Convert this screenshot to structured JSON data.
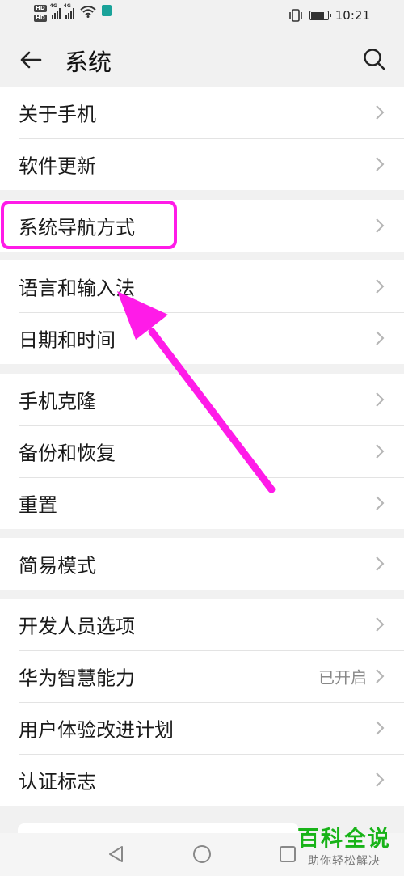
{
  "status_bar": {
    "hd_badges": [
      "HD",
      "HD"
    ],
    "network_labels": [
      "4G",
      "4G"
    ],
    "time": "10:21",
    "battery_level": 0.85
  },
  "app_bar": {
    "title": "系统"
  },
  "groups": [
    {
      "items": [
        {
          "label": "关于手机"
        },
        {
          "label": "软件更新"
        }
      ]
    },
    {
      "items": [
        {
          "label": "系统导航方式"
        }
      ]
    },
    {
      "items": [
        {
          "label": "语言和输入法"
        },
        {
          "label": "日期和时间"
        }
      ]
    },
    {
      "items": [
        {
          "label": "手机克隆"
        },
        {
          "label": "备份和恢复"
        },
        {
          "label": "重置"
        }
      ]
    },
    {
      "items": [
        {
          "label": "简易模式"
        }
      ]
    },
    {
      "items": [
        {
          "label": "开发人员选项"
        },
        {
          "label": "华为智慧能力",
          "value": "已开启"
        },
        {
          "label": "用户体验改进计划"
        },
        {
          "label": "认证标志"
        }
      ]
    }
  ],
  "annotation": {
    "color": "#ff1be8"
  },
  "watermark": {
    "title": "百科全说",
    "subtitle": "助你轻松解决"
  },
  "icons": [
    "back-arrow-icon",
    "search-icon",
    "chevron-right-icon",
    "nav-back-icon",
    "nav-home-icon",
    "nav-recents-icon"
  ]
}
